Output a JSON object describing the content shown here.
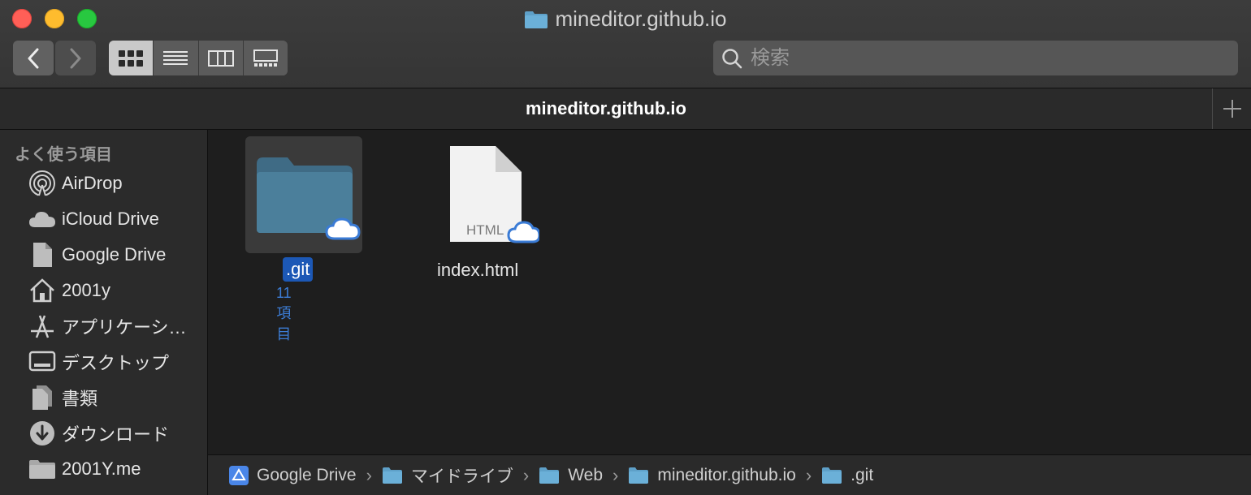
{
  "window": {
    "title": "mineditor.github.io"
  },
  "toolbar": {
    "back": "back",
    "forward": "forward",
    "views": [
      "icon-view",
      "list-view",
      "column-view",
      "gallery-view"
    ],
    "active_view": "icon-view",
    "search_placeholder": "検索"
  },
  "tab": {
    "title": "mineditor.github.io"
  },
  "sidebar": {
    "header": "よく使う項目",
    "items": [
      {
        "label": "AirDrop",
        "icon": "airdrop-icon"
      },
      {
        "label": "iCloud Drive",
        "icon": "cloud-icon"
      },
      {
        "label": "Google Drive",
        "icon": "document-icon"
      },
      {
        "label": "2001y",
        "icon": "home-icon"
      },
      {
        "label": "アプリケーシ…",
        "icon": "applications-icon"
      },
      {
        "label": "デスクトップ",
        "icon": "desktop-icon"
      },
      {
        "label": "書類",
        "icon": "documents-icon"
      },
      {
        "label": "ダウンロード",
        "icon": "download-icon"
      },
      {
        "label": "2001Y.me",
        "icon": "folder-icon"
      }
    ]
  },
  "files": [
    {
      "name": ".git",
      "subtitle": "11項目",
      "type": "folder",
      "selected": true
    },
    {
      "name": "index.html",
      "type": "html",
      "type_label": "HTML"
    }
  ],
  "pathbar": {
    "crumbs": [
      "Google Drive",
      "マイドライブ",
      "Web",
      "mineditor.github.io",
      ".git"
    ]
  },
  "colors": {
    "selection": "#1c58b6",
    "folder": "#5ea0c8",
    "cloud_badge": "#3a7bd5"
  }
}
